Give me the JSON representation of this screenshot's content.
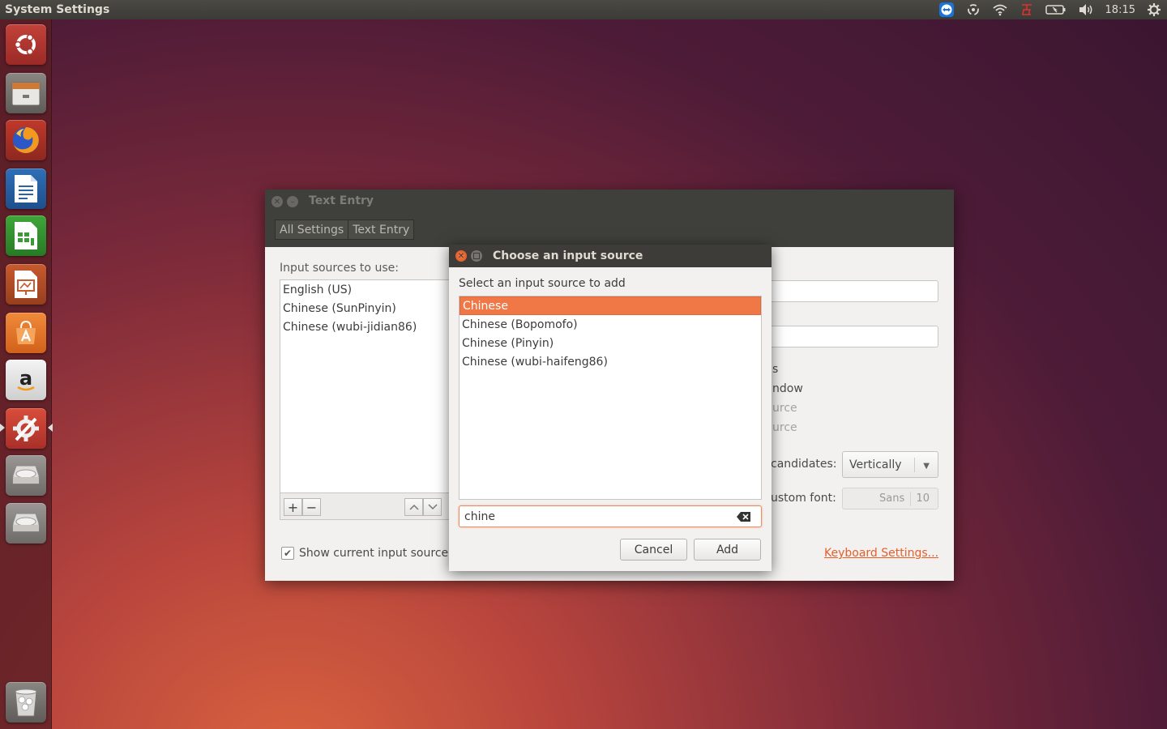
{
  "top_panel": {
    "title": "System Settings",
    "clock": "18:15"
  },
  "launcher": {
    "items": [
      "ubuntu-dash",
      "files",
      "firefox",
      "libreoffice-writer",
      "libreoffice-calc",
      "libreoffice-impress",
      "ubuntu-software",
      "amazon",
      "system-settings",
      "disk-1",
      "disk-2",
      "trash"
    ]
  },
  "settings_window": {
    "title": "Text Entry",
    "breadcrumbs": [
      "All Settings",
      "Text Entry"
    ],
    "sources_label": "Input sources to use:",
    "sources": [
      "English (US)",
      "Chinese (SunPinyin)",
      "Chinese (wubi-jidian86)"
    ],
    "show_current_label": "Show current input source i",
    "partial_labels": [
      "s",
      "ndow",
      "urce",
      "urce",
      "candidates:",
      "ustom font:"
    ],
    "candidates_value": "Vertically",
    "font_name": "Sans",
    "font_size": "10",
    "keyboard_settings_link": "Keyboard Settings..."
  },
  "dialog": {
    "title": "Choose an input source",
    "prompt": "Select an input source to add",
    "items": [
      "Chinese",
      "Chinese (Bopomofo)",
      "Chinese (Pinyin)",
      "Chinese (wubi-haifeng86)"
    ],
    "selected_index": 0,
    "search_value": "chine",
    "cancel_label": "Cancel",
    "add_label": "Add"
  },
  "colors": {
    "accent": "#f07746",
    "link": "#e45f2a",
    "titlebar": "#3d3c38"
  }
}
